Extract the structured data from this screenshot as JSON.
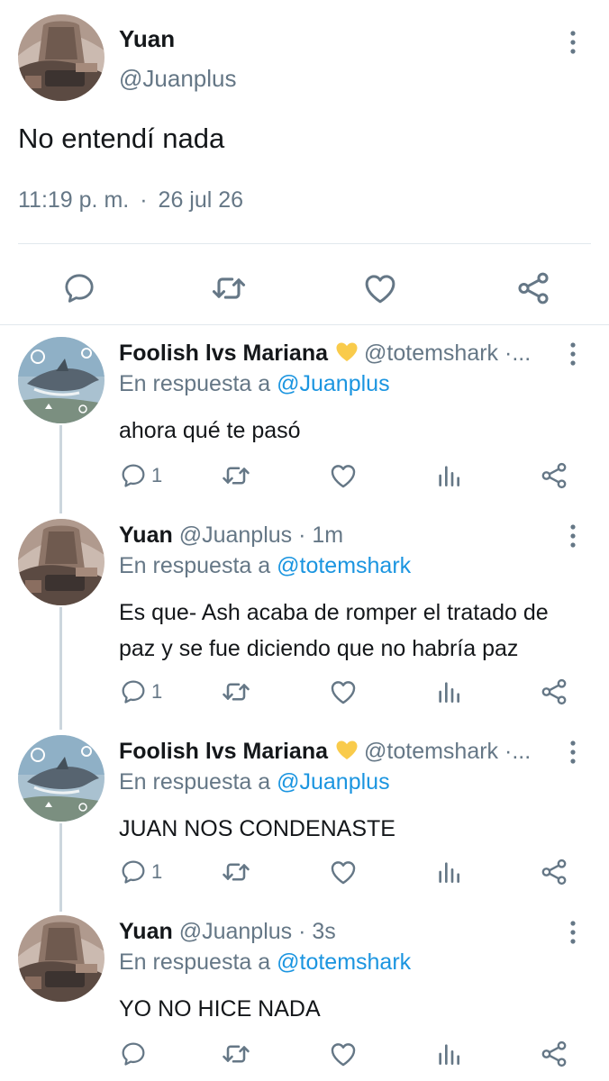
{
  "main_tweet": {
    "name": "Yuan",
    "handle": "@Juanplus",
    "text": "No entendí nada",
    "time": "11:19 p. m.",
    "separator": "·",
    "date": "26 jul 26",
    "actions": [
      "reply-icon",
      "retweet-icon",
      "like-icon",
      "share-icon"
    ]
  },
  "replies": [
    {
      "name": "Foolish lvs Mariana",
      "emoji": "yellow-heart",
      "handle_meta": "@totemshark ·...",
      "replying_prefix": "En respuesta a",
      "replying_to": "@Juanplus",
      "text": "ahora qué te pasó",
      "reply_count": "1"
    },
    {
      "name": "Yuan",
      "handle_meta": "@Juanplus · 1m",
      "replying_prefix": "En respuesta a",
      "replying_to": "@totemshark",
      "text": "Es que- Ash acaba de romper el tratado de paz y se fue diciendo que no habría paz",
      "reply_count": "1"
    },
    {
      "name": "Foolish lvs Mariana",
      "emoji": "yellow-heart",
      "handle_meta": "@totemshark ·...",
      "replying_prefix": "En respuesta a",
      "replying_to": "@Juanplus",
      "text": "JUAN NOS CONDENASTE",
      "reply_count": "1"
    },
    {
      "name": "Yuan",
      "handle_meta": "@Juanplus · 3s",
      "replying_prefix": "En respuesta a",
      "replying_to": "@totemshark",
      "text": "YO NO HICE NADA",
      "reply_count": ""
    }
  ],
  "colors": {
    "text": "#14171a",
    "secondary": "#657786",
    "link": "#1b95e0",
    "divider": "#e1e8ed",
    "thread_line": "#ccd6dd",
    "heart_emoji": "#f9cb4b"
  }
}
